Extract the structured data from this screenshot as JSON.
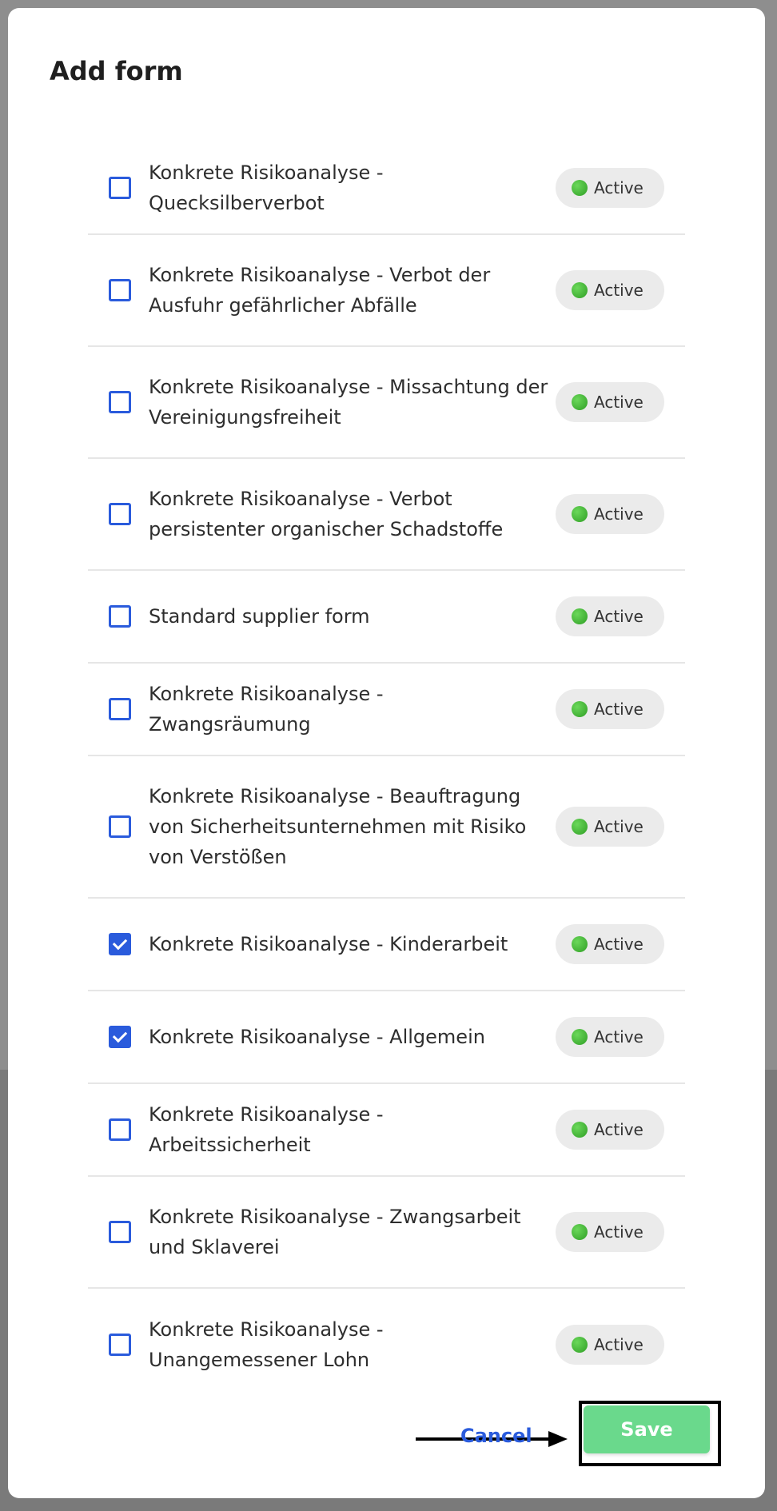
{
  "modal": {
    "title": "Add form"
  },
  "forms": [
    {
      "label": "Konkrete Risikoanalyse - Quecksilberverbot",
      "status": "Active",
      "checked": false
    },
    {
      "label": "Konkrete Risikoanalyse - Verbot der Ausfuhr gefährlicher Abfälle",
      "status": "Active",
      "checked": false
    },
    {
      "label": "Konkrete Risikoanalyse - Missachtung der Vereinigungsfreiheit",
      "status": "Active",
      "checked": false
    },
    {
      "label": "Konkrete Risikoanalyse - Verbot persistenter organischer Schadstoffe",
      "status": "Active",
      "checked": false
    },
    {
      "label": "Standard supplier form",
      "status": "Active",
      "checked": false
    },
    {
      "label": "Konkrete Risikoanalyse - Zwangsräumung",
      "status": "Active",
      "checked": false
    },
    {
      "label": "Konkrete Risikoanalyse - Beauftragung von Sicherheitsunternehmen mit Risiko von Verstößen",
      "status": "Active",
      "checked": false
    },
    {
      "label": "Konkrete Risikoanalyse - Kinderarbeit",
      "status": "Active",
      "checked": true
    },
    {
      "label": "Konkrete Risikoanalyse - Allgemein",
      "status": "Active",
      "checked": true
    },
    {
      "label": "Konkrete Risikoanalyse - Arbeitssicherheit",
      "status": "Active",
      "checked": false
    },
    {
      "label": "Konkrete Risikoanalyse - Zwangsarbeit und Sklaverei",
      "status": "Active",
      "checked": false
    },
    {
      "label": "Konkrete Risikoanalyse - Unangemessener Lohn",
      "status": "Active",
      "checked": false
    }
  ],
  "footer": {
    "cancel_label": "Cancel",
    "save_label": "Save"
  },
  "colors": {
    "accent": "#2a5bdc",
    "save_button": "#6ad98c",
    "status_active": "#3fb52f",
    "badge_bg": "#ebebeb"
  },
  "icons": {
    "status": "green-dot-icon",
    "checkbox_checked": "checkmark-icon",
    "annotation": "right-arrow-icon"
  }
}
